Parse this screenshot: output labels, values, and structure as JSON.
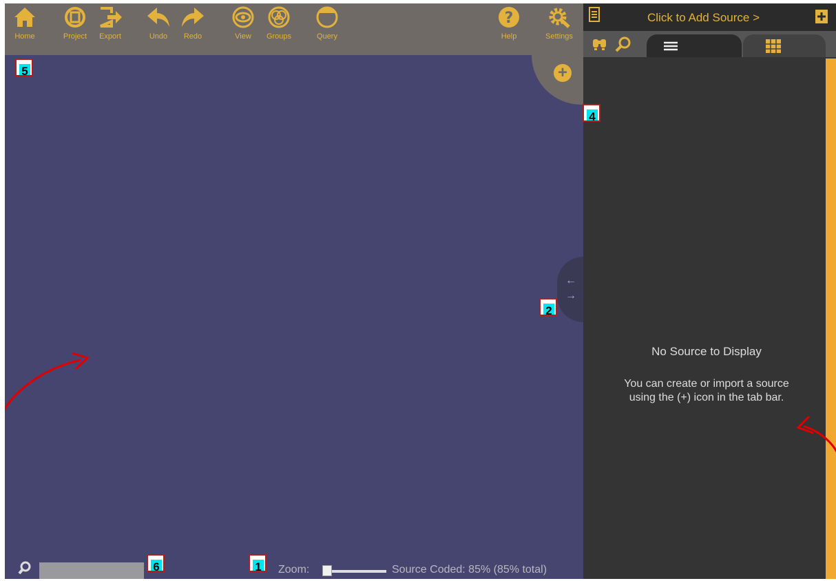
{
  "toolbar": {
    "items": [
      {
        "label": "Home",
        "icon": "home-icon"
      },
      {
        "label": "Project",
        "icon": "project-icon"
      },
      {
        "label": "Export",
        "icon": "export-icon"
      },
      {
        "label": "Undo",
        "icon": "undo-icon"
      },
      {
        "label": "Redo",
        "icon": "redo-icon"
      },
      {
        "label": "View",
        "icon": "eye-icon"
      },
      {
        "label": "Groups",
        "icon": "groups-icon"
      },
      {
        "label": "Query",
        "icon": "query-icon"
      },
      {
        "label": "Help",
        "icon": "help-icon"
      },
      {
        "label": "Settings",
        "icon": "settings-icon"
      }
    ]
  },
  "canvas": {
    "add_label": "+"
  },
  "splitter": {
    "left_arrow": "←",
    "right_arrow": "→"
  },
  "bottom": {
    "search_placeholder": "",
    "zoom_label": "Zoom:",
    "zoom_value": 0.05,
    "coded_text": "Source Coded: 85% (85% total)"
  },
  "right_panel": {
    "add_source": "Click to Add Source >",
    "empty_title": "No Source to Display",
    "empty_desc_1": "You can create or import a source",
    "empty_desc_2": "using the (+) icon in the tab bar."
  },
  "markers": [
    "5",
    "4",
    "2",
    "6",
    "1"
  ],
  "colors": {
    "accent": "#e3b23c",
    "canvas": "#454570",
    "panel": "#343434",
    "arrow": "#e00000"
  }
}
